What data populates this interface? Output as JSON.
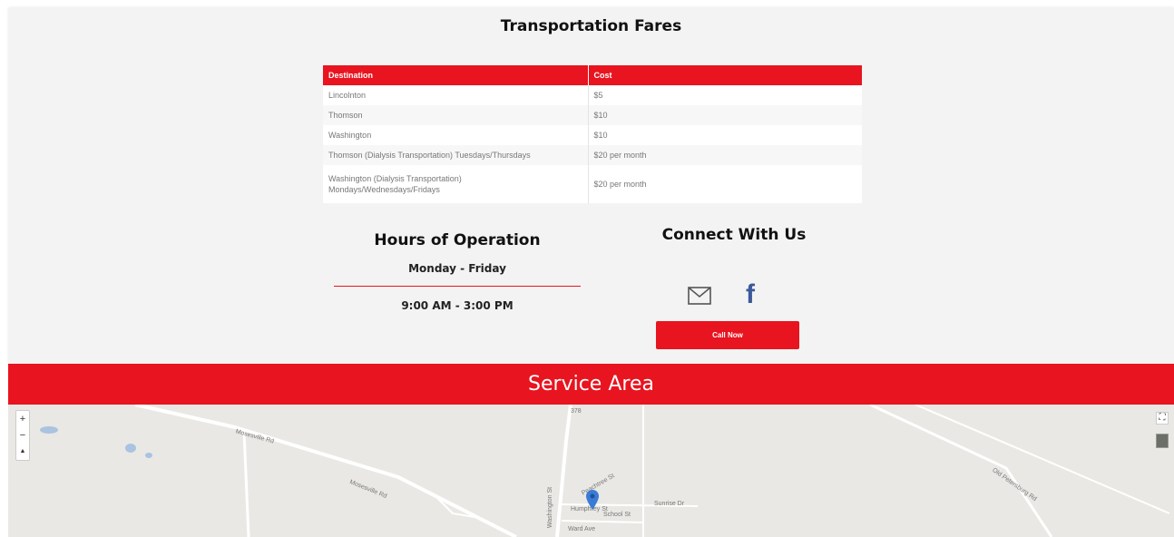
{
  "fares": {
    "title": "Transportation Fares",
    "columns": [
      "Destination",
      "Cost"
    ],
    "rows": [
      {
        "destination": "Lincolnton",
        "cost": "$5"
      },
      {
        "destination": "Thomson",
        "cost": "$10"
      },
      {
        "destination": "Washington",
        "cost": "$10"
      },
      {
        "destination": "Thomson (Dialysis Transportation) Tuesdays/Thursdays",
        "cost": "$20 per month"
      },
      {
        "destination_line1": "Washington (Dialysis Transportation)",
        "destination_line2": "Mondays/Wednesdays/Fridays",
        "cost": "$20 per month"
      }
    ]
  },
  "hours": {
    "title": "Hours of Operation",
    "days": "Monday - Friday",
    "time": "9:00 AM - 3:00 PM"
  },
  "connect": {
    "title": "Connect With Us",
    "email_icon": "mail-icon",
    "facebook_icon": "facebook-icon",
    "call_label": "Call Now"
  },
  "service_area": {
    "title": "Service Area"
  },
  "map": {
    "zoom_in": "+",
    "zoom_out": "−",
    "compass": "▲",
    "fullscreen": "⛶",
    "labels": {
      "mosesville_1": "Mosesville Rd",
      "mosesville_2": "Mosesville Rd",
      "route": "378",
      "washington_st": "Washington St",
      "school_st": "School St",
      "ward_ave": "Ward Ave",
      "sunrise_dr": "Sunrise Dr",
      "old_petersburg": "Old Petersburg Rd",
      "humphrey": "Humphrey St",
      "peachtree": "Peachtree St"
    },
    "colors": {
      "accent": "#e8141f",
      "pin": "#3a7bd5",
      "facebook": "#3b5a9a"
    }
  }
}
